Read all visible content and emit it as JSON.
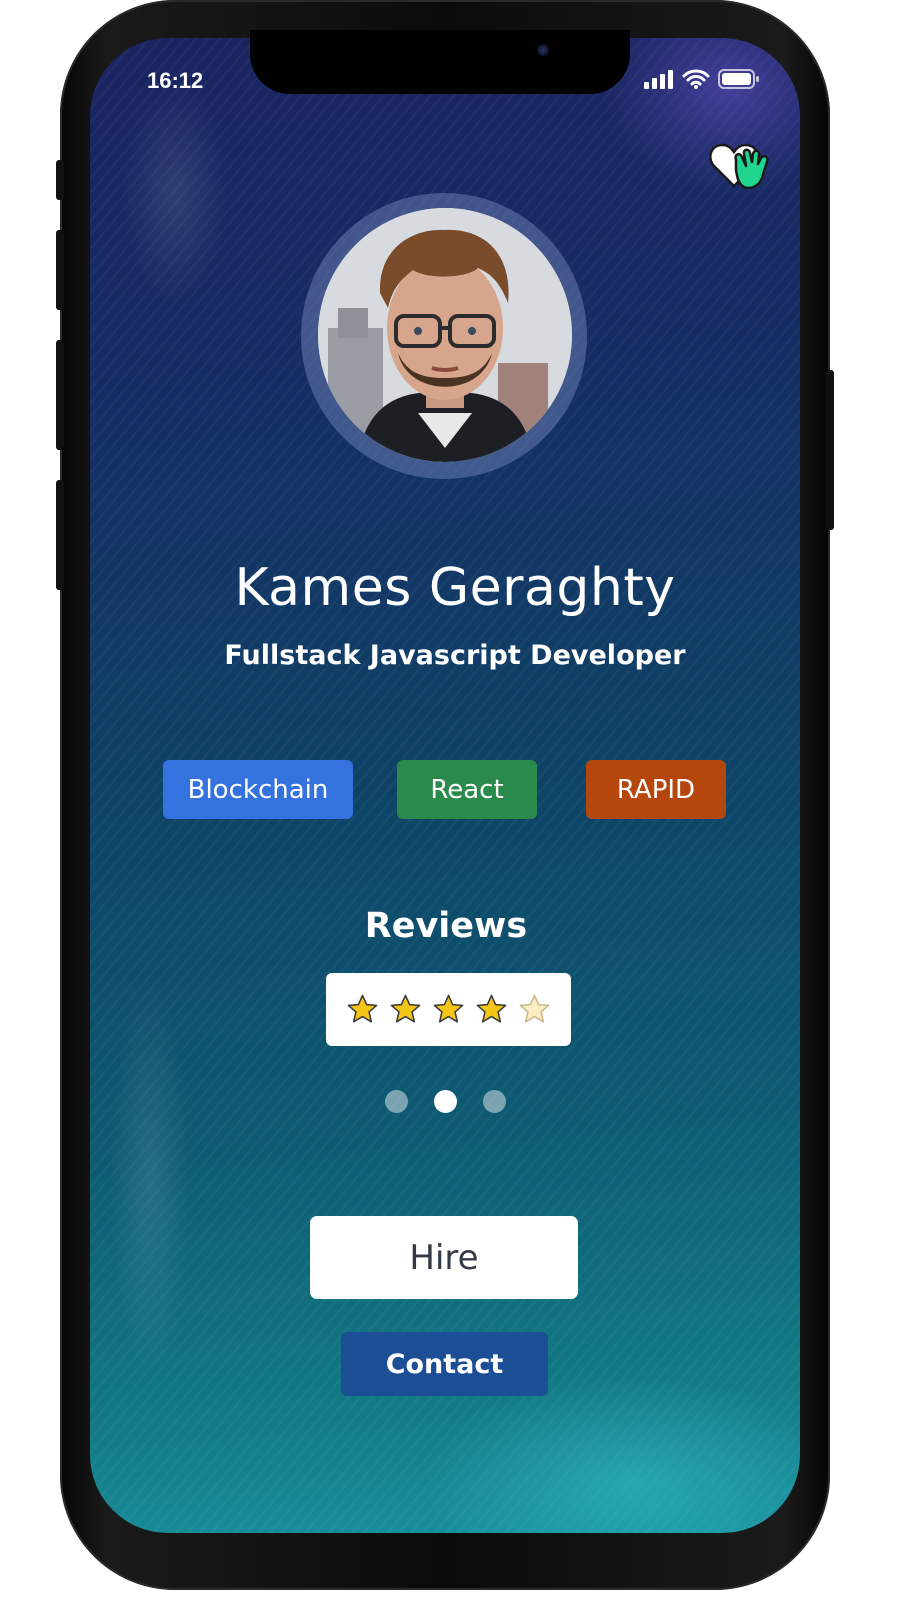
{
  "status_bar": {
    "time": "16:12",
    "icons": [
      "cellular-signal-icon",
      "wifi-icon",
      "battery-icon"
    ]
  },
  "app": {
    "logo_icon": "heart-hand-logo-icon"
  },
  "profile": {
    "avatar_icon": "profile-photo",
    "name": "Kames Geraghty",
    "role": "Fullstack Javascript Developer"
  },
  "skills": [
    {
      "label": "Blockchain",
      "color": "#3472e0"
    },
    {
      "label": "React",
      "color": "#2a8a4c"
    },
    {
      "label": "RAPID",
      "color": "#b6470c"
    }
  ],
  "reviews": {
    "title": "Reviews",
    "rating": 4,
    "max_rating": 5,
    "star_color": "#f5c518",
    "carousel_total": 3,
    "carousel_active": 2
  },
  "actions": {
    "hire_label": "Hire",
    "contact_label": "Contact",
    "contact_color": "#1b4e94"
  }
}
